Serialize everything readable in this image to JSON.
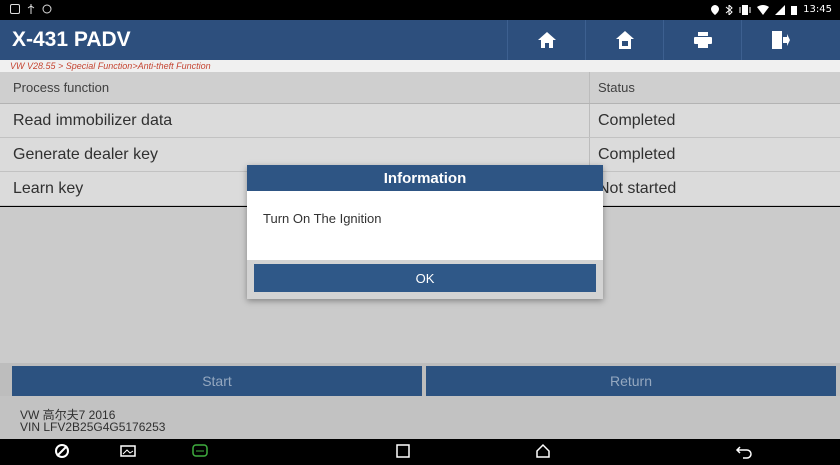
{
  "statusbar": {
    "time": "13:45",
    "icons": [
      "notification-icon",
      "usb-icon",
      "settings-icon",
      "location-icon",
      "bluetooth-icon",
      "vibrate-icon",
      "wifi-icon",
      "signal-icon",
      "battery-icon"
    ]
  },
  "header": {
    "title": "X-431 PADV",
    "buttons": [
      "home-icon",
      "vehicle-home-icon",
      "print-icon",
      "exit-icon"
    ]
  },
  "breadcrumb": "VW V28.55 > Special Function>Anti-theft Function",
  "table": {
    "headers": {
      "function": "Process function",
      "status": "Status"
    },
    "rows": [
      {
        "function": "Read immobilizer data",
        "status": "Completed"
      },
      {
        "function": "Generate dealer key",
        "status": "Completed"
      },
      {
        "function": "Learn key",
        "status": "Not started"
      }
    ]
  },
  "buttons": {
    "start": "Start",
    "return": "Return"
  },
  "vehicle": {
    "model": "VW 高尔夫7 2016",
    "vin": "VIN LFV2B25G4G5176253"
  },
  "dialog": {
    "title": "Information",
    "message": "Turn On The Ignition",
    "ok": "OK"
  },
  "colors": {
    "header": "#2d4f7d",
    "button": "#2f5888",
    "breadcrumb": "#d24a36"
  }
}
